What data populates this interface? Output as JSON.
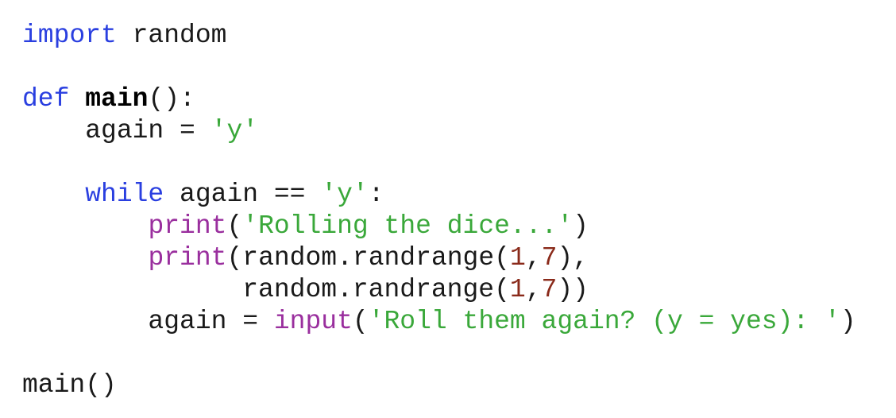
{
  "language": "python",
  "colors": {
    "keyword": "#2a3fe0",
    "builtin": "#9a2f9e",
    "string": "#3aa83a",
    "number": "#8a2a1a",
    "default": "#1a1a1a"
  },
  "lines": [
    [
      {
        "t": "kw",
        "v": "import"
      },
      {
        "t": "",
        "v": " random"
      }
    ],
    [],
    [
      {
        "t": "kw",
        "v": "def"
      },
      {
        "t": "",
        "v": " "
      },
      {
        "t": "fn",
        "v": "main"
      },
      {
        "t": "",
        "v": "():"
      }
    ],
    [
      {
        "t": "",
        "v": "    again = "
      },
      {
        "t": "str",
        "v": "'y'"
      }
    ],
    [],
    [
      {
        "t": "",
        "v": "    "
      },
      {
        "t": "kw",
        "v": "while"
      },
      {
        "t": "",
        "v": " again == "
      },
      {
        "t": "str",
        "v": "'y'"
      },
      {
        "t": "",
        "v": ":"
      }
    ],
    [
      {
        "t": "",
        "v": "        "
      },
      {
        "t": "bi",
        "v": "print"
      },
      {
        "t": "",
        "v": "("
      },
      {
        "t": "str",
        "v": "'Rolling the dice...'"
      },
      {
        "t": "",
        "v": ")"
      }
    ],
    [
      {
        "t": "",
        "v": "        "
      },
      {
        "t": "bi",
        "v": "print"
      },
      {
        "t": "",
        "v": "(random.randrange("
      },
      {
        "t": "num",
        "v": "1"
      },
      {
        "t": "",
        "v": ","
      },
      {
        "t": "num",
        "v": "7"
      },
      {
        "t": "",
        "v": "),"
      }
    ],
    [
      {
        "t": "",
        "v": "              random.randrange("
      },
      {
        "t": "num",
        "v": "1"
      },
      {
        "t": "",
        "v": ","
      },
      {
        "t": "num",
        "v": "7"
      },
      {
        "t": "",
        "v": "))"
      }
    ],
    [
      {
        "t": "",
        "v": "        again = "
      },
      {
        "t": "bi",
        "v": "input"
      },
      {
        "t": "",
        "v": "("
      },
      {
        "t": "str",
        "v": "'Roll them again? (y = yes): '"
      },
      {
        "t": "",
        "v": ")"
      }
    ],
    [],
    [
      {
        "t": "",
        "v": "main()"
      }
    ]
  ]
}
